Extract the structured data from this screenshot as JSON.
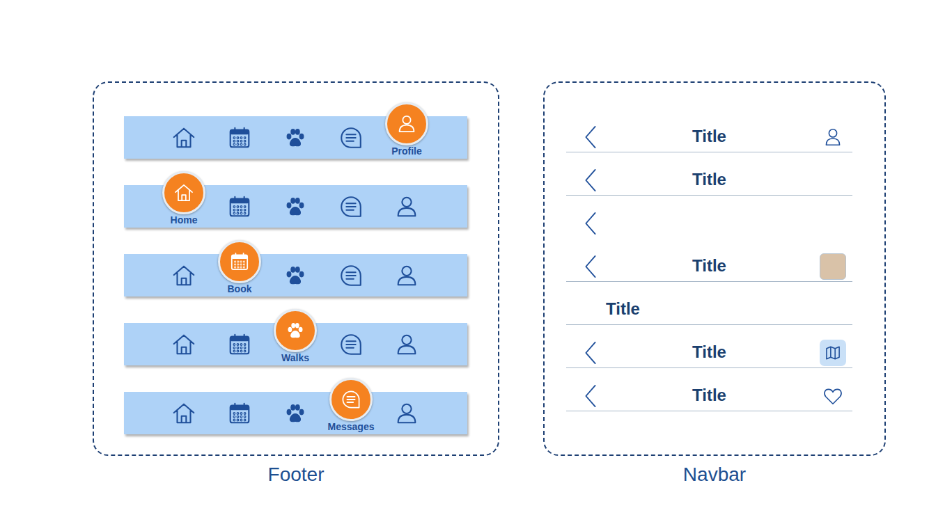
{
  "footer": {
    "caption": "Footer",
    "bars": [
      {
        "label": "Profile",
        "items": [
          {
            "selected": false
          },
          {
            "selected": false
          },
          {
            "selected": false
          },
          {
            "selected": false
          },
          {
            "selected": true
          }
        ]
      },
      {
        "label": "Home",
        "items": [
          {
            "selected": true
          },
          {
            "selected": false
          },
          {
            "selected": false
          },
          {
            "selected": false
          },
          {
            "selected": false
          }
        ]
      },
      {
        "label": "Book",
        "items": [
          {
            "selected": false
          },
          {
            "selected": true
          },
          {
            "selected": false
          },
          {
            "selected": false
          },
          {
            "selected": false
          }
        ]
      },
      {
        "label": "Walks",
        "items": [
          {
            "selected": false
          },
          {
            "selected": false
          },
          {
            "selected": true
          },
          {
            "selected": false
          },
          {
            "selected": false
          }
        ]
      },
      {
        "label": "Messages",
        "items": [
          {
            "selected": false
          },
          {
            "selected": false
          },
          {
            "selected": false
          },
          {
            "selected": true
          },
          {
            "selected": false
          }
        ]
      }
    ]
  },
  "navbar": {
    "caption": "Navbar",
    "rows": [
      {
        "back": true,
        "title": "Title",
        "kind": "profile",
        "divider": true
      },
      {
        "back": true,
        "title": "Title",
        "kind": "plain",
        "divider": true
      },
      {
        "back": true,
        "kind": "plain",
        "divider": false
      },
      {
        "back": true,
        "title": "Title",
        "kind": "avatar",
        "divider": true
      },
      {
        "back": false,
        "title": "Title",
        "kind": "plain",
        "divider": true
      },
      {
        "back": true,
        "title": "Title",
        "kind": "map",
        "divider": true
      },
      {
        "back": true,
        "title": "Title",
        "kind": "heart",
        "divider": true
      }
    ]
  }
}
